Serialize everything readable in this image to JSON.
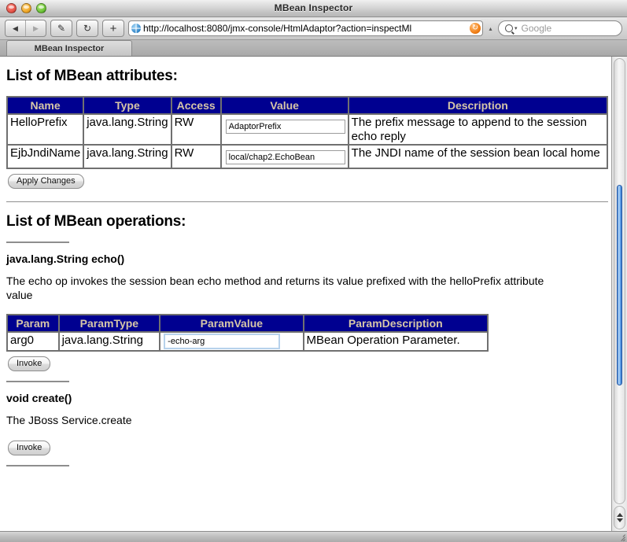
{
  "window": {
    "title": "MBean Inspector",
    "traffic_lights": [
      "close-button",
      "minimize-button",
      "zoom-button"
    ]
  },
  "toolbar": {
    "back_glyph": "◀",
    "forward_glyph": "▶",
    "edit_glyph": "✎",
    "reload_glyph": "↻",
    "add_glyph": "+",
    "url": "http://localhost:8080/jmx-console/HtmlAdaptor?action=inspectMl",
    "url_reload_glyph": "↻",
    "url_caret_glyph": "▴",
    "search_caret_glyph": "▾",
    "search_placeholder": "Google"
  },
  "tabs": [
    {
      "label": "MBean Inspector",
      "active": true
    }
  ],
  "attributes_section": {
    "heading": "List of MBean attributes:",
    "columns": [
      "Name",
      "Type",
      "Access",
      "Value",
      "Description"
    ],
    "rows": [
      {
        "name": "HelloPrefix",
        "type": "java.lang.String",
        "access": "RW",
        "value": "AdaptorPrefix",
        "description": "The prefix message to append to the session echo reply"
      },
      {
        "name": "EjbJndiName",
        "type": "java.lang.String",
        "access": "RW",
        "value": "local/chap2.EchoBean",
        "description": "The JNDI name of the session bean local home"
      }
    ],
    "apply_label": "Apply Changes"
  },
  "operations_section": {
    "heading": "List of MBean operations:",
    "operations": [
      {
        "signature": "java.lang.String echo()",
        "description": "The echo op invokes the session bean echo method and returns its value prefixed with the helloPrefix attribute value",
        "columns": [
          "Param",
          "ParamType",
          "ParamValue",
          "ParamDescription"
        ],
        "params": [
          {
            "param": "arg0",
            "param_type": "java.lang.String",
            "param_value": "-echo-arg",
            "param_description": "MBean Operation Parameter."
          }
        ],
        "invoke_label": "Invoke"
      },
      {
        "signature": "void create()",
        "description": "The JBoss Service.create",
        "columns": [],
        "params": [],
        "invoke_label": "Invoke"
      }
    ]
  },
  "colors": {
    "table_header_bg": "#000090",
    "table_header_text": "#d6c6a8",
    "table_border": "#707070",
    "scrollbar_thumb": "#3f7fd4",
    "page_bg": "#ffffff"
  }
}
